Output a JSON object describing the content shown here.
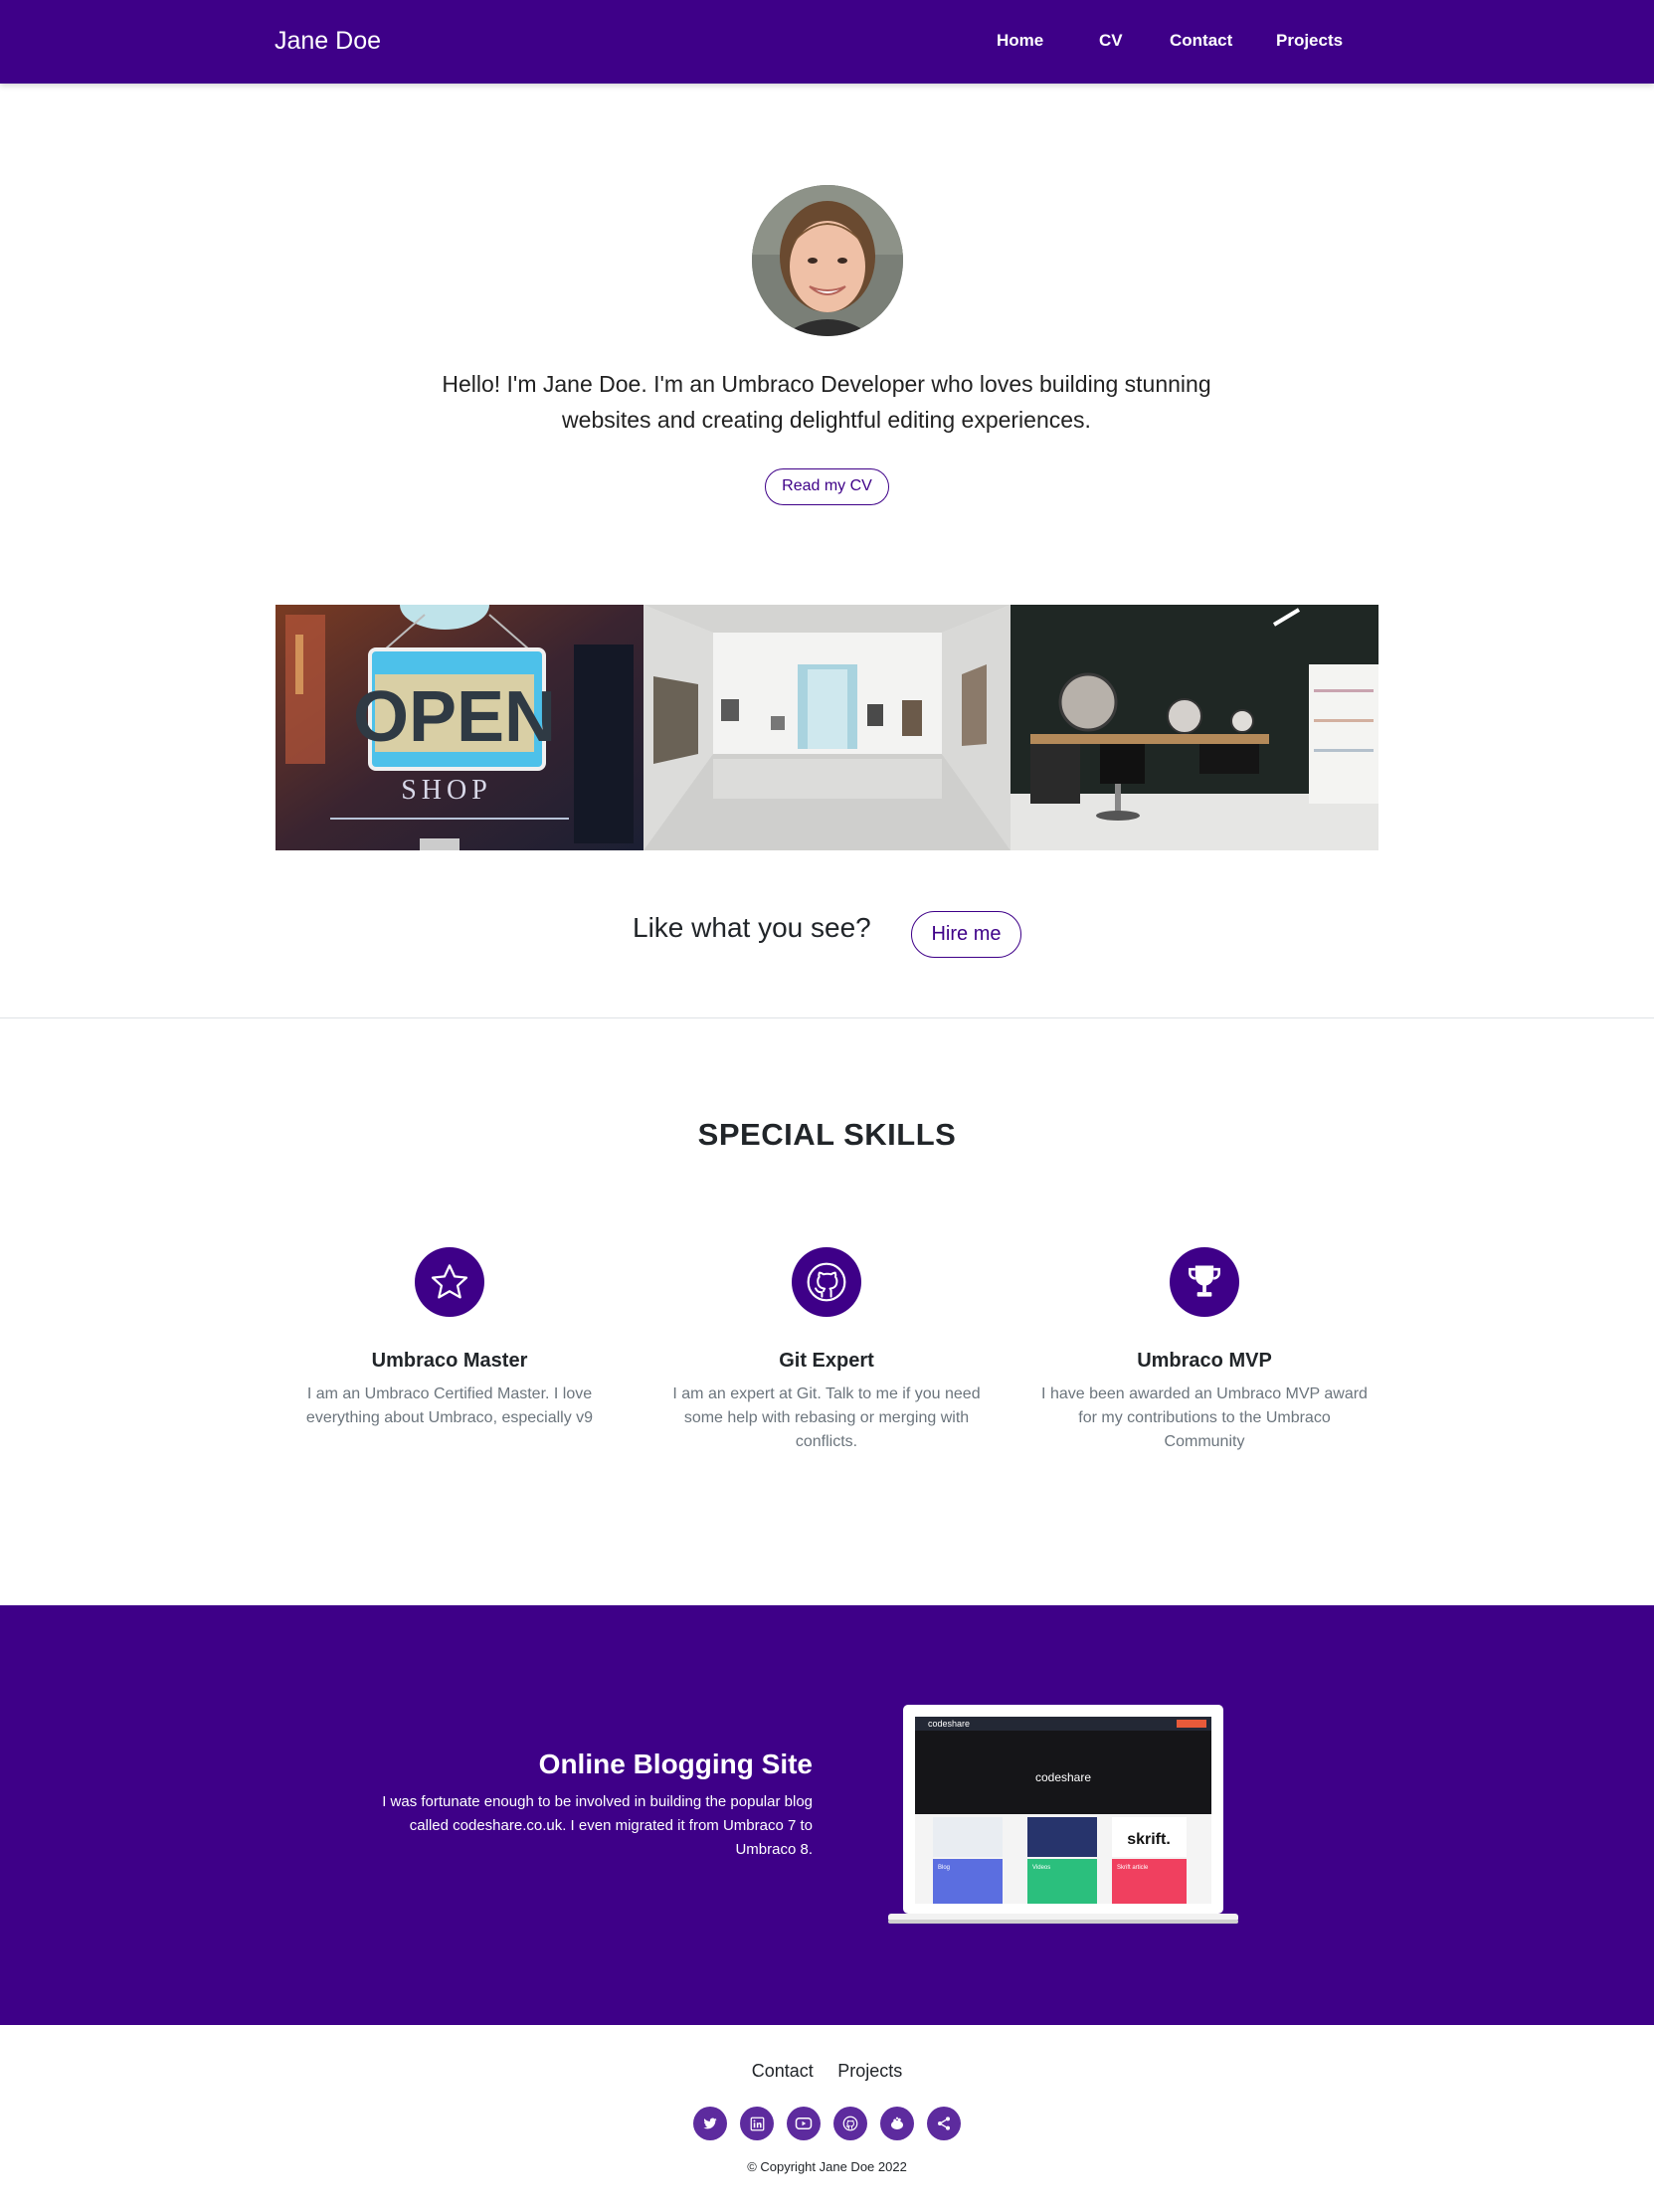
{
  "nav": {
    "brand": "Jane Doe",
    "items": [
      {
        "label": "Home"
      },
      {
        "label": "CV"
      },
      {
        "label": "Contact"
      },
      {
        "label": "Projects"
      }
    ]
  },
  "hero": {
    "intro": "Hello! I'm Jane Doe. I'm an Umbraco Developer who loves building stunning websites and creating delightful editing experiences.",
    "cv_button": "Read my CV"
  },
  "gallery": {
    "open_sign_text": "OPEN",
    "shop_text": "SHOP"
  },
  "cta": {
    "text": "Like what you see?",
    "button": "Hire me"
  },
  "skills": {
    "title": "SPECIAL SKILLS",
    "items": [
      {
        "icon": "star-icon",
        "title": "Umbraco Master",
        "text": "I am an Umbraco Certified Master. I love everything about Umbraco, especially v9"
      },
      {
        "icon": "github-icon",
        "title": "Git Expert",
        "text": "I am an expert at Git. Talk to me if you need some help with rebasing or merging with conflicts."
      },
      {
        "icon": "trophy-icon",
        "title": "Umbraco MVP",
        "text": "I have been awarded an Umbraco MVP award for my contributions to the Umbraco Community"
      }
    ]
  },
  "feature": {
    "title": "Online Blogging Site",
    "text": "I was fortunate enough to be involved in building the popular blog called codeshare.co.uk. I even migrated it from Umbraco 7 to Umbraco 8.",
    "screenshot": {
      "logo": "codeshare",
      "hero_logo": "codeshare",
      "cards": [
        "Blog",
        "Videos",
        "Skrift article"
      ],
      "skrift": "skrift."
    }
  },
  "footer": {
    "links": [
      "Contact",
      "Projects"
    ],
    "socials": [
      "twitter-icon",
      "linkedin-icon",
      "youtube-icon",
      "github-icon",
      "umbraco-forum-icon",
      "share-icon"
    ],
    "copyright": "© Copyright Jane Doe 2022"
  },
  "colors": {
    "primary": "#3e0088",
    "social": "#5d2b9e",
    "muted": "#6c757d"
  }
}
